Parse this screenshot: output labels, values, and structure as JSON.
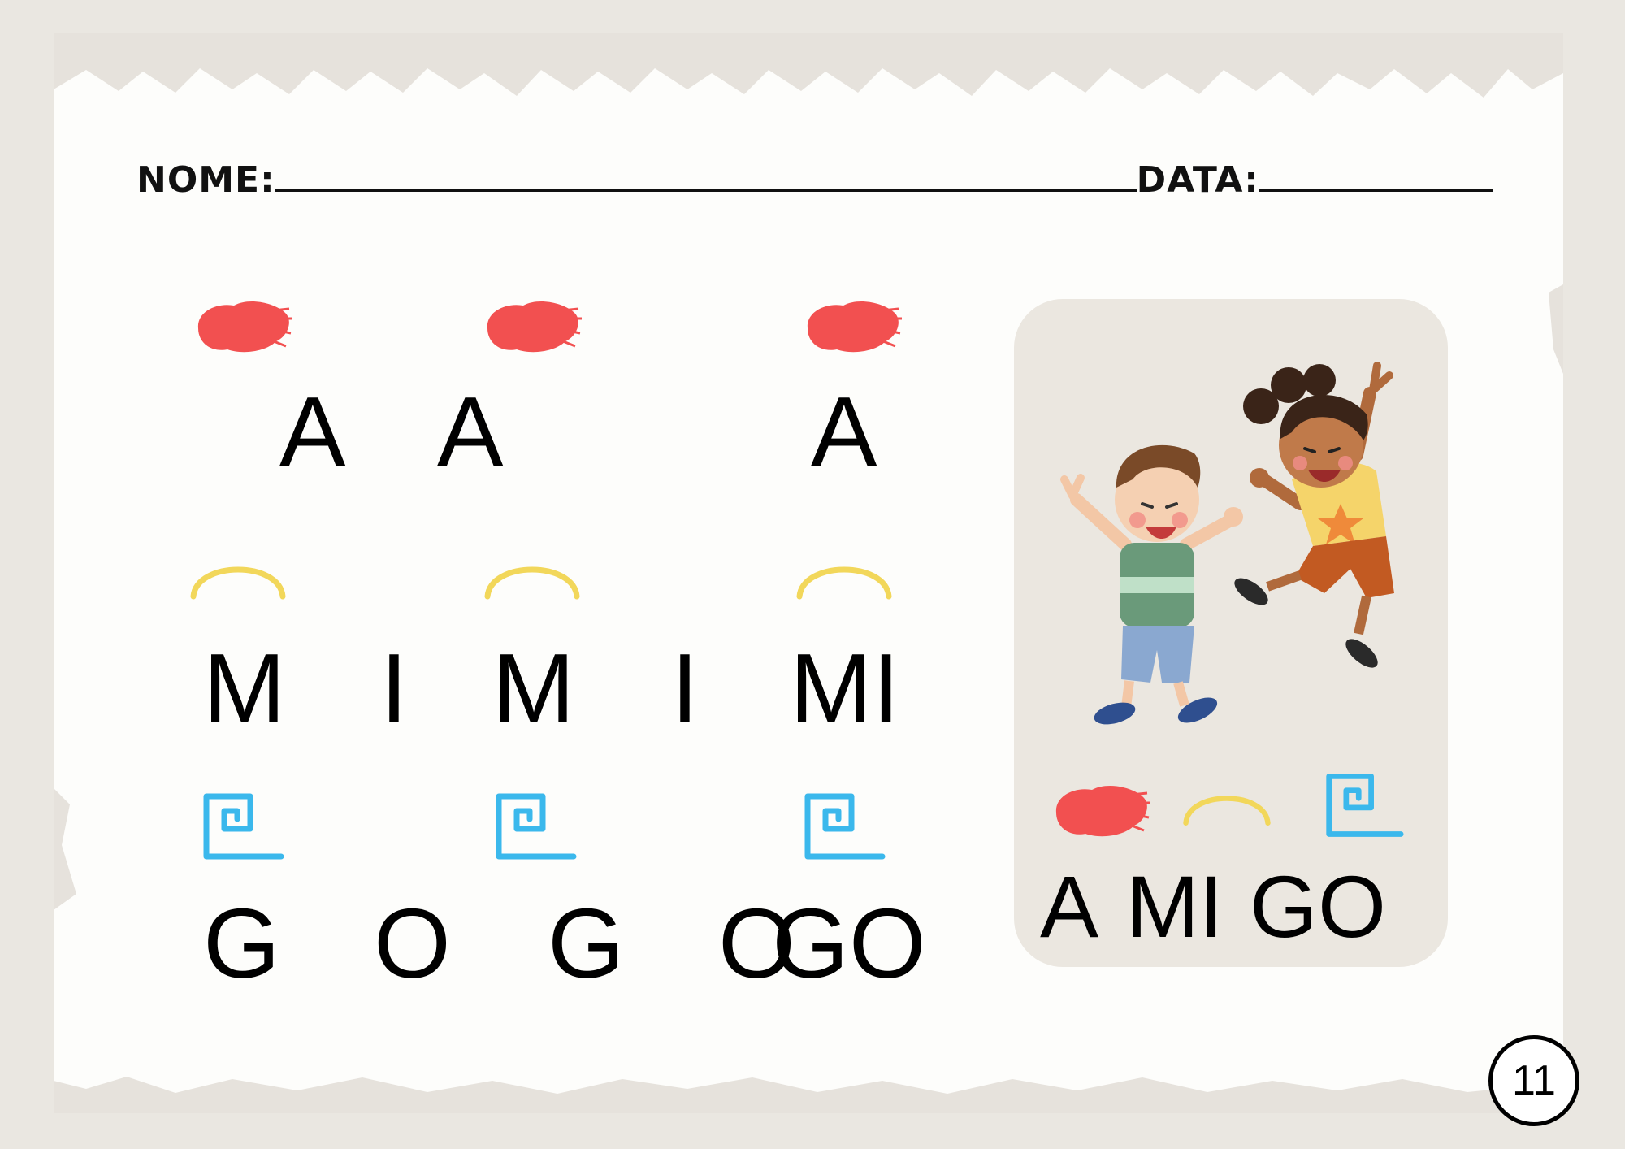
{
  "header": {
    "name_label": "NOME:",
    "date_label": "DATA:"
  },
  "rows": {
    "a": [
      "A",
      "A",
      "A"
    ],
    "mi": [
      "M",
      "I",
      "M",
      "I",
      "MI"
    ],
    "go": [
      "G",
      "O",
      "G",
      "O",
      "GO"
    ]
  },
  "card": {
    "syllables": [
      "A",
      "MI",
      "GO"
    ]
  },
  "page_number": "11",
  "colors": {
    "red_blob": "#f25050",
    "yellow_arc": "#f2d75a",
    "blue_spiral": "#3bb8ec",
    "card_bg": "#ebe7e0"
  },
  "icons": [
    "red-blob-icon",
    "yellow-arc-icon",
    "blue-spiral-icon",
    "children-illustration"
  ]
}
